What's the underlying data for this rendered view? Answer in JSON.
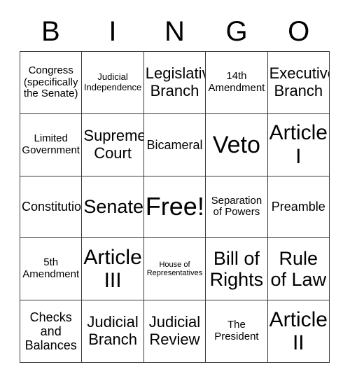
{
  "card": {
    "header_letters": [
      "B",
      "I",
      "N",
      "G",
      "O"
    ],
    "grid": {
      "rows": 5,
      "columns": 5,
      "border_color": "#3a3a3a",
      "background_color": "#ffffff",
      "text_color": "#000000"
    },
    "cells": [
      {
        "text": "Congress (specifically the Senate)",
        "size": "s-sm",
        "column": "B",
        "row": 1
      },
      {
        "text": "Judicial Independence",
        "size": "s-xs",
        "column": "I",
        "row": 1
      },
      {
        "text": "Legislative Branch",
        "size": "s-lg",
        "column": "N",
        "row": 1
      },
      {
        "text": "14th Amendment",
        "size": "s-sm",
        "column": "G",
        "row": 1
      },
      {
        "text": "Executive Branch",
        "size": "s-lg",
        "column": "O",
        "row": 1
      },
      {
        "text": "Limited Government",
        "size": "s-sm",
        "column": "B",
        "row": 2
      },
      {
        "text": "Supreme Court",
        "size": "s-lg",
        "column": "I",
        "row": 2
      },
      {
        "text": "Bicameral",
        "size": "s-md",
        "column": "N",
        "row": 2
      },
      {
        "text": "Veto",
        "size": "s-3xl",
        "column": "G",
        "row": 2
      },
      {
        "text": "Article I",
        "size": "s-2xl",
        "column": "O",
        "row": 2
      },
      {
        "text": "Constitution",
        "size": "s-md",
        "column": "B",
        "row": 3
      },
      {
        "text": "Senate",
        "size": "s-xl",
        "column": "I",
        "row": 3
      },
      {
        "text": "Free!",
        "size": "s-4xl",
        "column": "N",
        "row": 3
      },
      {
        "text": "Separation of Powers",
        "size": "s-sm",
        "column": "G",
        "row": 3
      },
      {
        "text": "Preamble",
        "size": "s-md",
        "column": "O",
        "row": 3
      },
      {
        "text": "5th Amendment",
        "size": "s-sm",
        "column": "B",
        "row": 4
      },
      {
        "text": "Article III",
        "size": "s-2xl",
        "column": "I",
        "row": 4
      },
      {
        "text": "House of Representatives",
        "size": "s-xxs",
        "column": "N",
        "row": 4
      },
      {
        "text": "Bill of Rights",
        "size": "s-xl",
        "column": "G",
        "row": 4
      },
      {
        "text": "Rule of Law",
        "size": "s-xl",
        "column": "O",
        "row": 4
      },
      {
        "text": "Checks and Balances",
        "size": "s-md",
        "column": "B",
        "row": 5
      },
      {
        "text": "Judicial Branch",
        "size": "s-lg",
        "column": "I",
        "row": 5
      },
      {
        "text": "Judicial Review",
        "size": "s-lg",
        "column": "N",
        "row": 5
      },
      {
        "text": "The President",
        "size": "s-sm",
        "column": "G",
        "row": 5
      },
      {
        "text": "Article II",
        "size": "s-2xl",
        "column": "O",
        "row": 5
      }
    ]
  }
}
